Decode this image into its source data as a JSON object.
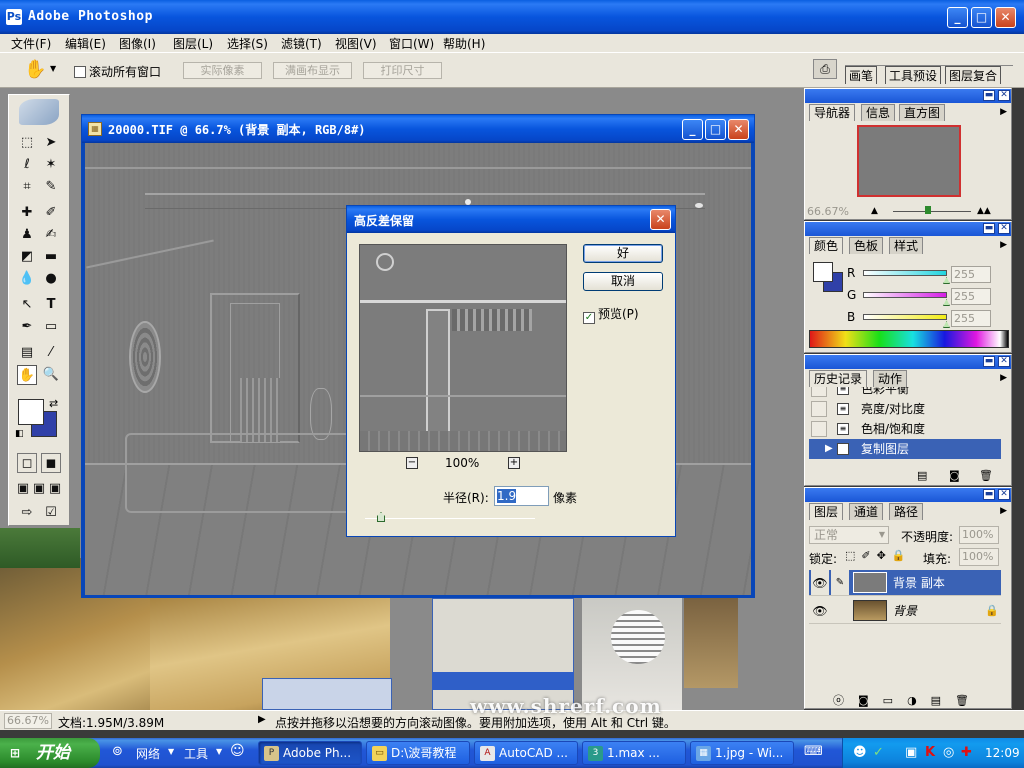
{
  "app": {
    "title": "Adobe Photoshop"
  },
  "menu": [
    "文件(F)",
    "编辑(E)",
    "图像(I)",
    "图层(L)",
    "选择(S)",
    "滤镜(T)",
    "视图(V)",
    "窗口(W)",
    "帮助(H)"
  ],
  "options": {
    "scroll_all": "滚动所有窗口",
    "actual_pixels": "实际像素",
    "fit_screen": "满画布显示",
    "print_size": "打印尺寸",
    "tabs": [
      "画笔",
      "工具预设",
      "图层复合"
    ]
  },
  "document": {
    "title": "20000.TIF @ 66.7% (背景 副本, RGB/8#)"
  },
  "dialog": {
    "title": "高反差保留",
    "ok": "好",
    "cancel": "取消",
    "preview_label": "预览(P)",
    "preview_checked": true,
    "zoom": "100%",
    "radius_label": "半径(R):",
    "radius_value": "1.9",
    "radius_unit": "像素"
  },
  "navigator": {
    "tabs": [
      "导航器",
      "信息",
      "直方图"
    ],
    "zoom": "66.67%"
  },
  "color": {
    "tabs": [
      "颜色",
      "色板",
      "样式"
    ],
    "channels": [
      {
        "label": "R",
        "value": "255",
        "color": "#21d4e0"
      },
      {
        "label": "G",
        "value": "255",
        "color": "#d51ee6"
      },
      {
        "label": "B",
        "value": "255",
        "color": "#f2ec16"
      }
    ]
  },
  "history": {
    "tabs": [
      "历史记录",
      "动作"
    ],
    "items": [
      "色彩平衡",
      "亮度/对比度",
      "色相/饱和度",
      "复制图层"
    ]
  },
  "layers": {
    "tabs": [
      "图层",
      "通道",
      "路径"
    ],
    "blend_mode": "正常",
    "opacity_label": "不透明度:",
    "opacity": "100%",
    "lock_label": "锁定:",
    "fill_label": "填充:",
    "fill": "100%",
    "items": [
      "背景 副本",
      "背景"
    ]
  },
  "status": {
    "zoom": "66.67%",
    "doc_info": "文档:1.95M/3.89M",
    "hint": "点按并拖移以沿想要的方向滚动图像。要用附加选项，使用 Alt 和 Ctrl 键。"
  },
  "watermark": "www.shrerf.com",
  "taskbar": {
    "start": "开始",
    "quick": [
      "网络",
      "工具"
    ],
    "tasks": [
      "Adobe Ph...",
      "D:\\波哥教程",
      "AutoCAD ...",
      "1.max    ...",
      "1.jpg - Wi..."
    ],
    "clock": "12:09"
  }
}
